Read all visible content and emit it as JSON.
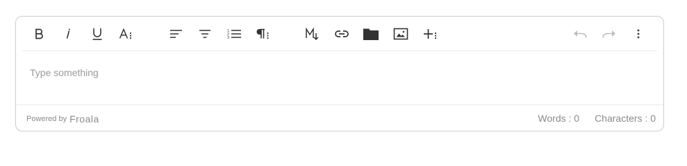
{
  "editor": {
    "placeholder": "Type something"
  },
  "toolbar": {
    "buttons": [
      {
        "name": "bold",
        "icon": "bold-icon"
      },
      {
        "name": "italic",
        "icon": "italic-icon"
      },
      {
        "name": "underline",
        "icon": "underline-icon"
      },
      {
        "name": "more-text",
        "icon": "text-more-icon"
      },
      {
        "name": "align-left",
        "icon": "align-left-icon"
      },
      {
        "name": "align-center",
        "icon": "align-center-icon"
      },
      {
        "name": "ordered-list",
        "icon": "ordered-list-icon"
      },
      {
        "name": "more-paragraph",
        "icon": "paragraph-more-icon"
      },
      {
        "name": "markdown",
        "icon": "markdown-icon"
      },
      {
        "name": "insert-link",
        "icon": "link-icon"
      },
      {
        "name": "insert-file",
        "icon": "folder-icon"
      },
      {
        "name": "insert-image",
        "icon": "image-icon"
      },
      {
        "name": "more-rich",
        "icon": "plus-more-icon"
      },
      {
        "name": "undo",
        "icon": "undo-icon",
        "disabled": true
      },
      {
        "name": "redo",
        "icon": "redo-icon",
        "disabled": true
      },
      {
        "name": "more-misc",
        "icon": "vertical-dots-icon"
      }
    ]
  },
  "footer": {
    "powered_by": "Powered by",
    "brand": "Froala",
    "words": "Words : 0",
    "characters": "Characters : 0"
  },
  "colors": {
    "icon": "#333333",
    "icon_disabled": "#bdbdbd",
    "placeholder": "#9a9a9a",
    "border": "#cccccc",
    "footer_text": "#8a8a8a"
  }
}
